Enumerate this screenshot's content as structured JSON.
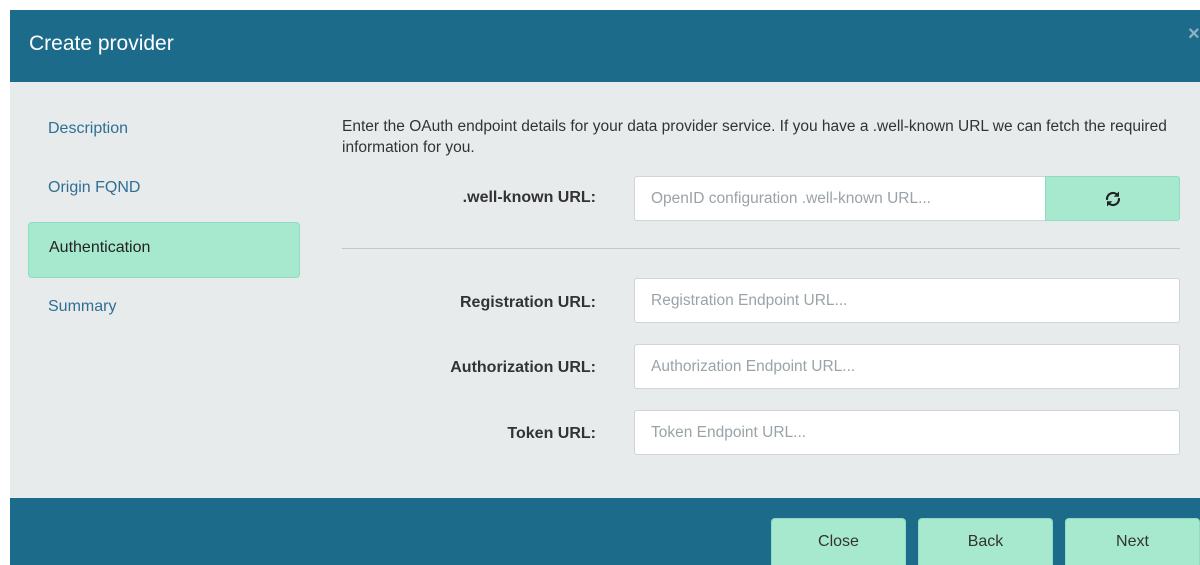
{
  "dialog": {
    "title": "Create provider",
    "close_glyph": "×"
  },
  "sidebar": {
    "items": [
      {
        "label": "Description",
        "active": false
      },
      {
        "label": "Origin FQND",
        "active": false
      },
      {
        "label": "Authentication",
        "active": true
      },
      {
        "label": "Summary",
        "active": false
      }
    ]
  },
  "main": {
    "intro": "Enter the OAuth endpoint details for your data provider service. If you have a .well-known URL we can fetch the required information for you.",
    "well_known": {
      "label": ".well-known URL:",
      "placeholder": "OpenID configuration .well-known URL...",
      "value": "",
      "button_icon": "refresh-icon"
    },
    "fields": [
      {
        "label": "Registration URL:",
        "placeholder": "Registration Endpoint URL...",
        "value": ""
      },
      {
        "label": "Authorization URL:",
        "placeholder": "Authorization Endpoint URL...",
        "value": ""
      },
      {
        "label": "Token URL:",
        "placeholder": "Token Endpoint URL...",
        "value": ""
      }
    ]
  },
  "footer": {
    "close_label": "Close",
    "back_label": "Back",
    "next_label": "Next"
  },
  "colors": {
    "header_bg": "#1d6b8b",
    "accent": "#a7e9cf",
    "panel_bg": "#e8ebec",
    "link": "#2f6f95"
  }
}
